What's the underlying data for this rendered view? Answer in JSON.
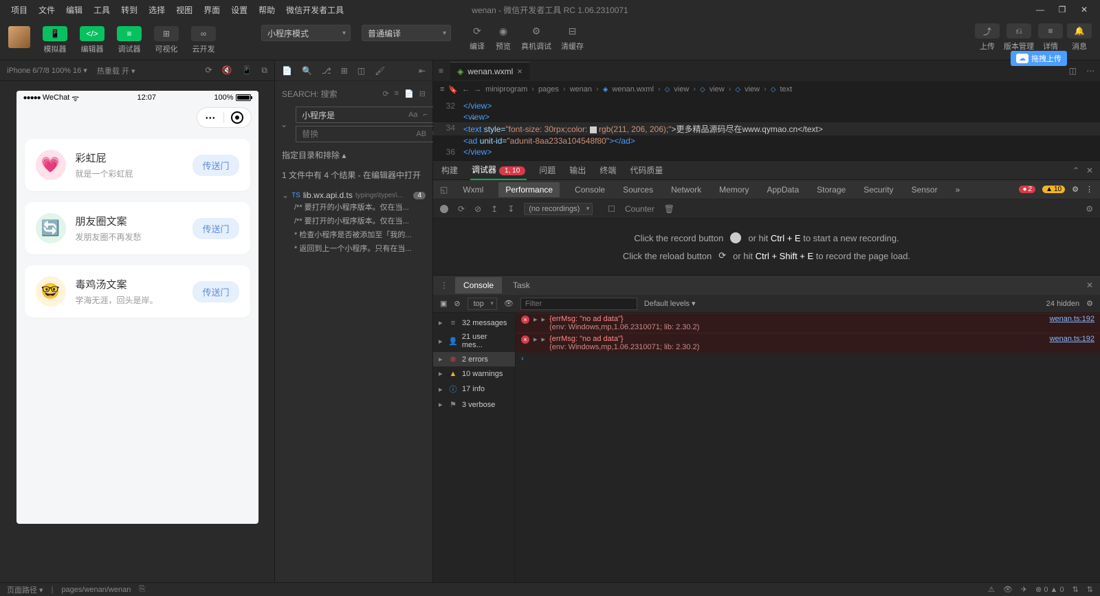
{
  "window": {
    "title": "wenan - 微信开发者工具 RC 1.06.2310071",
    "menu": [
      "项目",
      "文件",
      "编辑",
      "工具",
      "转到",
      "选择",
      "视图",
      "界面",
      "设置",
      "帮助",
      "微信开发者工具"
    ]
  },
  "toolbar": {
    "simulator": "模拟器",
    "editor": "编辑器",
    "debugger": "调试器",
    "visualize": "可视化",
    "cloud": "云开发",
    "mode_select": "小程序模式",
    "compile_select": "普通编译",
    "compile": "编译",
    "preview": "预览",
    "remote": "真机调试",
    "clear_cache": "清缓存",
    "upload": "上传",
    "version": "版本管理",
    "details": "详情",
    "message": "消息",
    "drag_upload": "拖拽上传"
  },
  "sim": {
    "device": "iPhone 6/7/8 100% 16 ▾",
    "hot_reload": "热重载 开 ▾",
    "status_carrier": "WeChat",
    "time": "12:07",
    "battery": "100%",
    "cards": [
      {
        "title": "彩虹屁",
        "desc": "就是一个彩虹屁",
        "btn": "传送门",
        "emoji": "💗",
        "bgClass": "pink"
      },
      {
        "title": "朋友圈文案",
        "desc": "发朋友圈不再发愁",
        "btn": "传送门",
        "emoji": "🔄",
        "bgClass": "green"
      },
      {
        "title": "毒鸡汤文案",
        "desc": "学海无涯，回头是岸。",
        "btn": "传送门",
        "emoji": "🤓",
        "bgClass": "yellow"
      }
    ]
  },
  "search": {
    "label": "SEARCH: 搜索",
    "query": "小程序是",
    "replace_placeholder": "替换",
    "scope": "指定目录和排除 ▴",
    "result_summary": "1 文件中有 4 个结果 - 在编辑器中打开",
    "file": "lib.wx.api.d.ts",
    "file_path": "typings\\types\\...",
    "file_count": "4",
    "hits": [
      "/** 要打开的小程序版本。仅在当...",
      "/** 要打开的小程序版本。仅在当...",
      "* 检查小程序是否被添加至「我的...",
      "* 返回到上一个小程序。只有在当..."
    ]
  },
  "editor": {
    "tab": "wenan.wxml",
    "breadcrumb": [
      "miniprogram",
      "pages",
      "wenan",
      "wenan.wxml",
      "view",
      "view",
      "view",
      "text"
    ],
    "lines": {
      "l32": "</view>",
      "l33": "<view>",
      "l34_pre": "<text",
      "l34_attr": "style=",
      "l34_val1": "\"font-size: 30rpx;color: ",
      "l34_val2": "rgb(211, 206, 206);\"",
      "l34_txt": ">更多精品源码尽在www.qymao.cn</text>",
      "l35_pre": "<ad",
      "l35_attr": "unit-id=",
      "l35_val": "\"adunit-8aa233a104548f80\"",
      "l35_end": "></ad>",
      "l36": "</view>"
    }
  },
  "devtools": {
    "header_tabs": [
      "构建",
      "调试器",
      "问题",
      "输出",
      "终端",
      "代码质量"
    ],
    "header_badge": "1, 10",
    "sub_tabs": [
      "Wxml",
      "Performance",
      "Console",
      "Sources",
      "Network",
      "Memory",
      "AppData",
      "Storage",
      "Security",
      "Sensor"
    ],
    "err_count": "2",
    "warn_count": "10",
    "perf": {
      "recordings": "(no recordings)",
      "counter": "Counter",
      "record_hint_pre": "Click the record button",
      "record_hint_post": "or hit Ctrl + E to start a new recording.",
      "reload_hint_pre": "Click the reload button",
      "reload_hint_post": "or hit Ctrl + Shift + E to record the page load."
    }
  },
  "console": {
    "tab_console": "Console",
    "tab_task": "Task",
    "context": "top",
    "filter_placeholder": "Filter",
    "levels": "Default levels ▾",
    "hidden": "24 hidden",
    "side": {
      "messages": "32 messages",
      "user": "21 user mes...",
      "errors": "2 errors",
      "warnings": "10 warnings",
      "info": "17 info",
      "verbose": "3 verbose"
    },
    "logs": [
      {
        "msg": "{errMsg: \"no ad data\"}",
        "env": "(env: Windows,mp,1.06.2310071; lib: 2.30.2)",
        "src": "wenan.ts:192"
      },
      {
        "msg": "{errMsg: \"no ad data\"}",
        "env": "(env: Windows,mp,1.06.2310071; lib: 2.30.2)",
        "src": "wenan.ts:192"
      }
    ]
  },
  "statusbar": {
    "page_path_label": "页面路径 ▾",
    "page_path": "pages/wenan/wenan",
    "errors": "0",
    "warnings": "0"
  }
}
